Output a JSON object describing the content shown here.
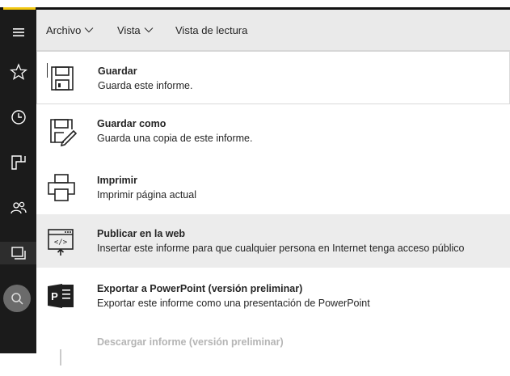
{
  "menubar": {
    "file": "Archivo",
    "view": "Vista",
    "reading_view": "Vista de lectura"
  },
  "file_menu": {
    "items": [
      {
        "title": "Guardar",
        "desc": "Guarda este informe.",
        "icon": "save-icon"
      },
      {
        "title": "Guardar como",
        "desc": "Guarda una copia de este informe.",
        "icon": "save-as-icon"
      },
      {
        "title": "Imprimir",
        "desc": "Imprimir página actual",
        "icon": "print-icon"
      },
      {
        "title": "Publicar en la web",
        "desc": "Insertar este informe para que cualquier persona en Internet tenga acceso público",
        "icon": "publish-web-icon"
      },
      {
        "title": "Exportar a PowerPoint (versión preliminar)",
        "desc": "Exportar este informe como una presentación de PowerPoint",
        "icon": "powerpoint-icon"
      },
      {
        "title": "Descargar informe (versión preliminar)",
        "desc": "",
        "icon": "download-icon"
      }
    ]
  },
  "sidebar": {
    "icons": [
      "hamburger-icon",
      "favorites-icon",
      "recent-icon",
      "apps-icon",
      "shared-icon",
      "workspaces-icon",
      "avatar"
    ]
  },
  "colors": {
    "accent": "#f2c811",
    "sidebar": "#1b1b1b",
    "menubar": "#eaeaea",
    "highlight": "#ececec",
    "powerpoint": "#1f1f1f"
  }
}
